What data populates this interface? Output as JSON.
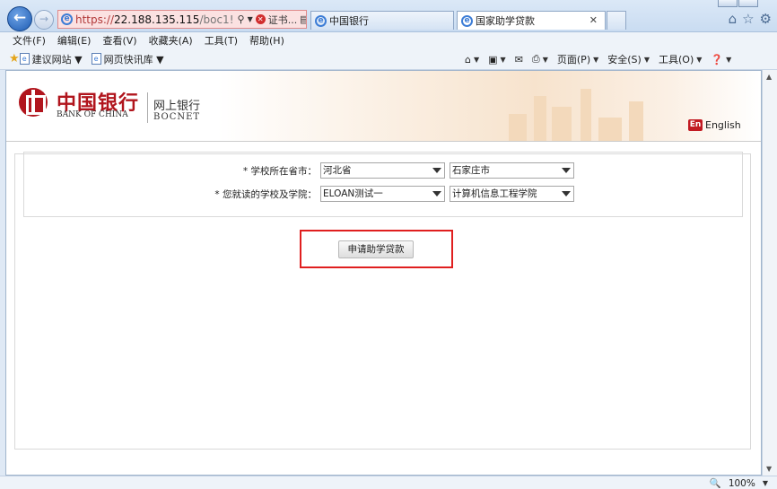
{
  "browser": {
    "address": {
      "scheme": "https://",
      "host": "22.188.135.115",
      "path": "/boc1!",
      "cert_label": "证书..."
    },
    "tabs": [
      {
        "label": "中国银行",
        "active": false
      },
      {
        "label": "国家助学贷款",
        "active": true
      }
    ],
    "menu": [
      "文件(F)",
      "编辑(E)",
      "查看(V)",
      "收藏夹(A)",
      "工具(T)",
      "帮助(H)"
    ],
    "favorites": [
      "建议网站 ▼",
      "网页快讯库 ▼"
    ],
    "commands": {
      "page": "页面(P)",
      "safety": "安全(S)",
      "tools": "工具(O)"
    },
    "zoom": "100%"
  },
  "header": {
    "logo_cn": "中国银行",
    "logo_en": "BANK OF CHINA",
    "product_cn": "网上银行",
    "product_en": "BOCNET",
    "lang_badge": "En",
    "lang_label": "English"
  },
  "form": {
    "province_label": "* 学校所在省市：",
    "province_value": "河北省",
    "city_value": "石家庄市",
    "school_label": "* 您就读的学校及学院：",
    "school_value": "ELOAN测试一",
    "college_value": "计算机信息工程学院"
  },
  "actions": {
    "apply_label": "申请助学贷款"
  },
  "colors": {
    "accent_red": "#b1151d",
    "highlight_border": "#e01f1f"
  }
}
